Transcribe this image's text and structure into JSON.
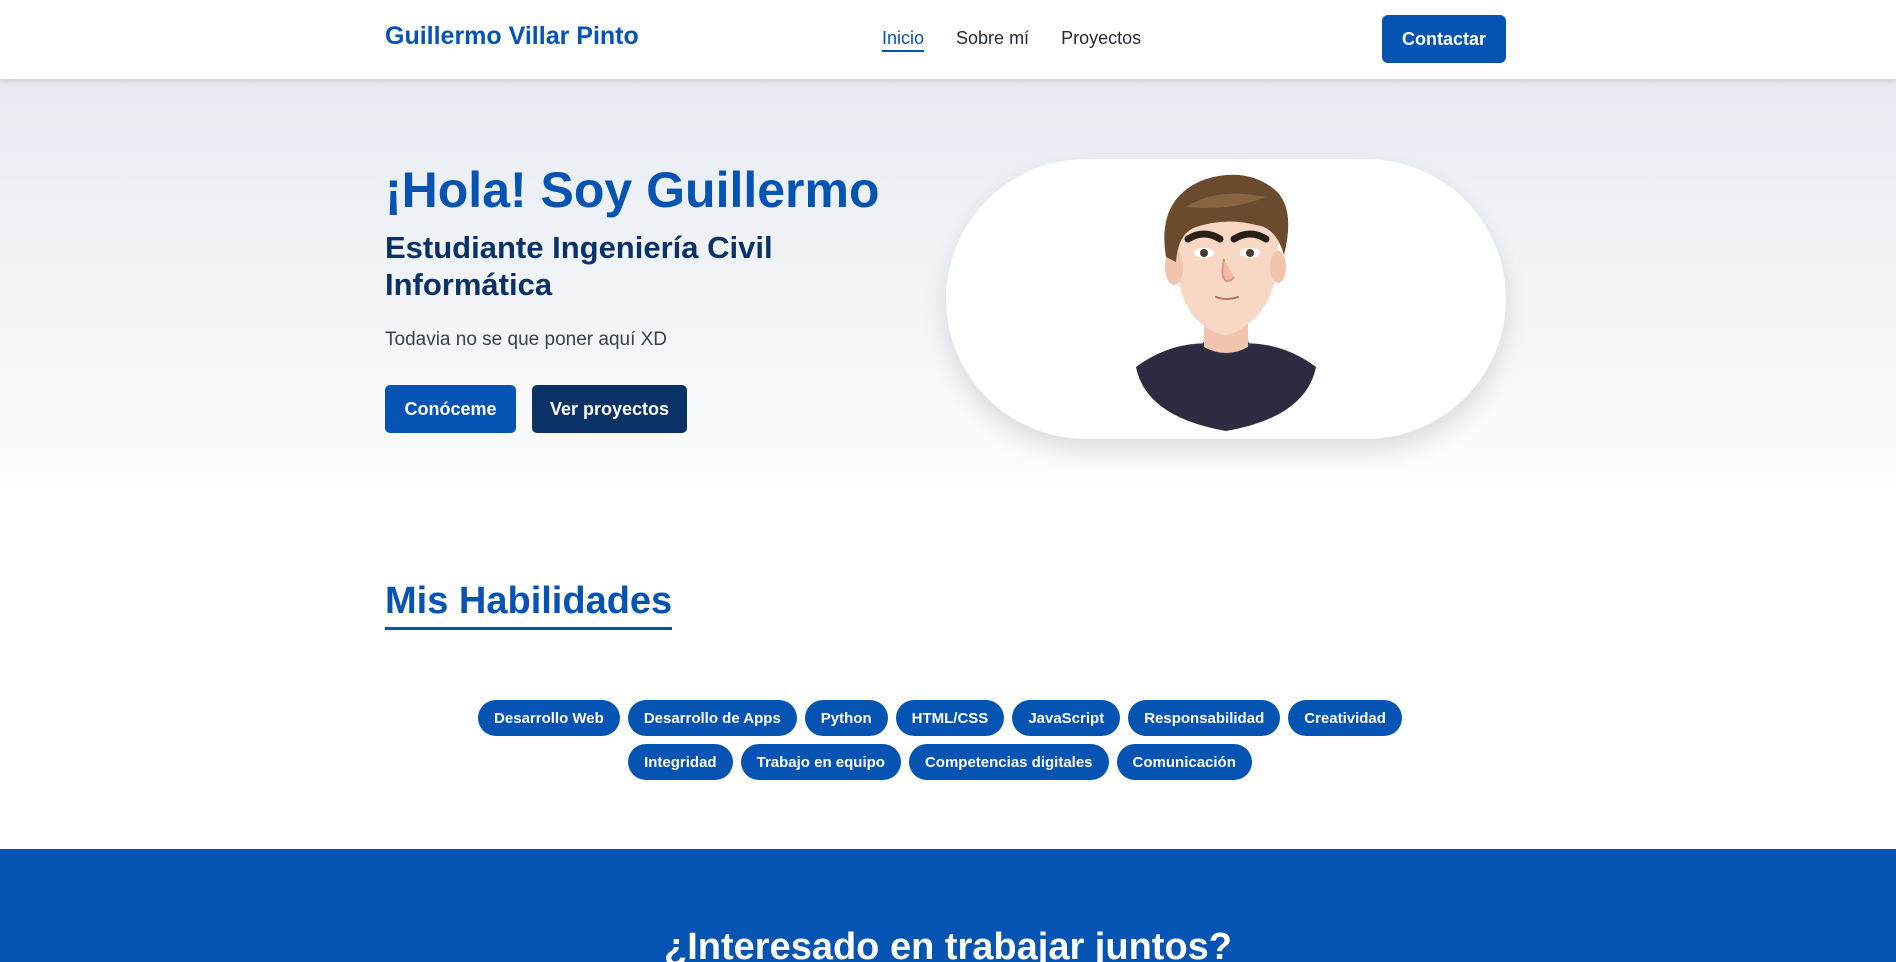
{
  "header": {
    "brand": "Guillermo Villar Pinto",
    "nav": [
      {
        "label": "Inicio",
        "active": true
      },
      {
        "label": "Sobre mí",
        "active": false
      },
      {
        "label": "Proyectos",
        "active": false
      }
    ],
    "contact_label": "Contactar"
  },
  "hero": {
    "title": "¡Hola! Soy Guillermo",
    "subtitle": "Estudiante Ingeniería Civil Informática",
    "text": "Todavia no se que poner aquí XD",
    "primary_button": "Conóceme",
    "secondary_button": "Ver proyectos"
  },
  "skills": {
    "title": "Mis Habilidades",
    "items": [
      "Desarrollo Web",
      "Desarrollo de Apps",
      "Python",
      "HTML/CSS",
      "JavaScript",
      "Responsabilidad",
      "Creatividad",
      "Integridad",
      "Trabajo en equipo",
      "Competencias digitales",
      "Comunicación"
    ]
  },
  "cta": {
    "title": "¿Interesado en trabajar juntos?"
  },
  "colors": {
    "primary": "#0554b3",
    "dark": "#0a3266"
  }
}
